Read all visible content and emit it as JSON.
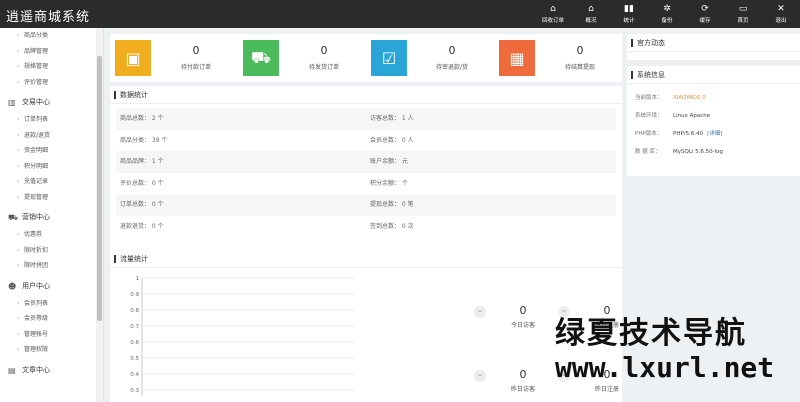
{
  "header": {
    "title": "逍遥商城系统",
    "nav": [
      {
        "label": "回收订单",
        "icon": "home-icon",
        "glyph": "⌂"
      },
      {
        "label": "概况",
        "icon": "home-icon",
        "glyph": "⌂"
      },
      {
        "label": "统计",
        "icon": "bar-chart-icon",
        "glyph": "▮▮"
      },
      {
        "label": "备份",
        "icon": "gear-icon",
        "glyph": "✲"
      },
      {
        "label": "缓存",
        "icon": "refresh-icon",
        "glyph": "⟳"
      },
      {
        "label": "首页",
        "icon": "monitor-icon",
        "glyph": "▭"
      },
      {
        "label": "退出",
        "icon": "close-icon",
        "glyph": "✕"
      }
    ]
  },
  "sidebar": {
    "items_top": [
      "商品分类",
      "品牌管理",
      "规格管理",
      "评价管理"
    ],
    "groups": [
      {
        "label": "交易中心",
        "icon": "chart-icon",
        "glyph": "▥",
        "items": [
          "订单列表",
          "退款/退货",
          "资金明细",
          "积分明细",
          "充值记录",
          "提现管理"
        ]
      },
      {
        "label": "营销中心",
        "icon": "truck-icon",
        "glyph": "⛟",
        "items": [
          "优惠券",
          "限时折扣",
          "限时拼团"
        ]
      },
      {
        "label": "用户中心",
        "icon": "user-icon",
        "glyph": "☻",
        "items": [
          "会员列表",
          "会员等级",
          "管理帐号",
          "管理权限"
        ]
      },
      {
        "label": "文章中心",
        "icon": "document-icon",
        "glyph": "▤",
        "items": []
      }
    ]
  },
  "stats": [
    {
      "value": "0",
      "label": "待付款订单",
      "color": "#f0ad1e",
      "icon": "wallet-icon",
      "glyph": "▣"
    },
    {
      "value": "0",
      "label": "待发货订单",
      "color": "#4cbb5b",
      "icon": "truck-icon",
      "glyph": "⛟"
    },
    {
      "value": "0",
      "label": "待审退款/货",
      "color": "#2aa5d8",
      "icon": "check-box-icon",
      "glyph": "☑"
    },
    {
      "value": "0",
      "label": "待结算提现",
      "color": "#ef6a3c",
      "icon": "calculator-icon",
      "glyph": "▦"
    }
  ],
  "data_panel": {
    "title": "数据统计",
    "rows": [
      [
        "商品总数： 2 个",
        "访客总数： 1 人"
      ],
      [
        "商品分类： 39 个",
        "会员总数： 0 人"
      ],
      [
        "商品品牌： 1 个",
        "账户余额： 元"
      ],
      [
        "评价总数： 0 个",
        "积分余额： 个"
      ],
      [
        "订单总数： 0 个",
        "提现总数： 0 笔"
      ],
      [
        "退款退货： 0 个",
        "签到总数： 0 次"
      ]
    ]
  },
  "traffic_panel": {
    "title": "流量统计",
    "cells": [
      {
        "value": "0",
        "label": "今日访客"
      },
      {
        "value": "0",
        "label": "今日注册"
      },
      {
        "value": "0",
        "label": "昨日访客"
      },
      {
        "value": "0",
        "label": "昨日注册"
      }
    ],
    "dot": "="
  },
  "chart_data": {
    "type": "line",
    "title": "",
    "xlabel": "",
    "ylabel": "",
    "ylim": [
      0,
      1
    ],
    "y_ticks": [
      "1",
      "0.9",
      "0.8",
      "0.7",
      "0.6",
      "0.5",
      "0.4",
      "0.3"
    ],
    "series": []
  },
  "right": {
    "official": {
      "title": "官方动态"
    },
    "sysinfo": {
      "title": "系统信息",
      "rows": [
        {
          "key": "当前版本：",
          "value": "XIAOYAO1.0",
          "accent": true
        },
        {
          "key": "系统环境：",
          "value": "Linux Apache"
        },
        {
          "key": "PHP版本：",
          "value": "PHP/5.6.40",
          "link": "[详细]"
        },
        {
          "key": "数 据 库：",
          "value": "MySQLi 5.6.50-log"
        }
      ]
    }
  },
  "watermark": {
    "line1": "绿夏技术导航",
    "line2": "www.lxurl.net"
  }
}
